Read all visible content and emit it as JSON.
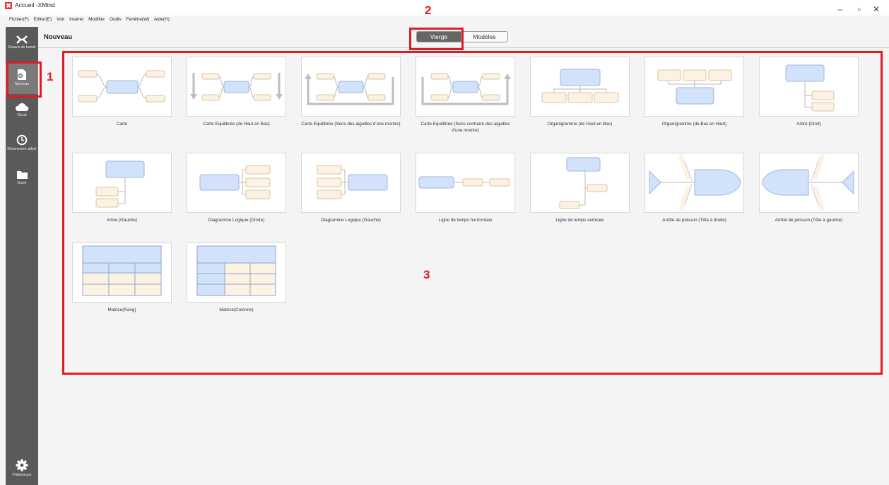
{
  "window": {
    "title": "Accueil -XMind",
    "logo_glyph": "✖",
    "minimize": "–",
    "restore": "▫",
    "close": "✕"
  },
  "menu": [
    "Fichier(F)",
    "Editer(E)",
    "Voir",
    "Insérer",
    "Modifier",
    "Outils",
    "Fenêtre(W)",
    "Aide(H)"
  ],
  "sidebar": {
    "workspace_label": "Espace de travail",
    "new_label": "Nouveau",
    "cloud_label": "Cloud",
    "recent_label": "Récemment utilisé",
    "open_label": "Ouvrir",
    "prefs_label": "Préférences"
  },
  "header": {
    "title": "Nouveau",
    "tab_blank": "Vierge",
    "tab_templates": "Modèles",
    "active_tab": "Vierge"
  },
  "annotations": {
    "one": "1",
    "two": "2",
    "three": "3",
    "color": "#e01b24"
  },
  "templates": [
    "Carte",
    "Carte Equilibrée (de Haut en Bas)",
    "Carte Equilibrée (Sens des aiguilles d'une montre)",
    "Carte Equilibrée (Sens contraire des aiguilles d'une montre)",
    "Organigramme (de Haut en Bas)",
    "Organigramme (de Bas en Haut)",
    "Arbre (Droit)",
    "Arbre (Gauche)",
    "Diagramme Logique (Droite)",
    "Diagramme Logique (Gauche)",
    "Ligne de temps horizontale",
    "Ligne de temps verticale",
    "Arrête de poisson (Tête à droite)",
    "Arrête de poisson (Tête à gauche)",
    "Matrice(Rang)",
    "Matrice(Colonne)"
  ],
  "colors": {
    "main_topic": "#d3e2fb",
    "sub_topic": "#fdf1e1",
    "line": "#b9b9b9",
    "sidebar": "#5a5a5a"
  }
}
